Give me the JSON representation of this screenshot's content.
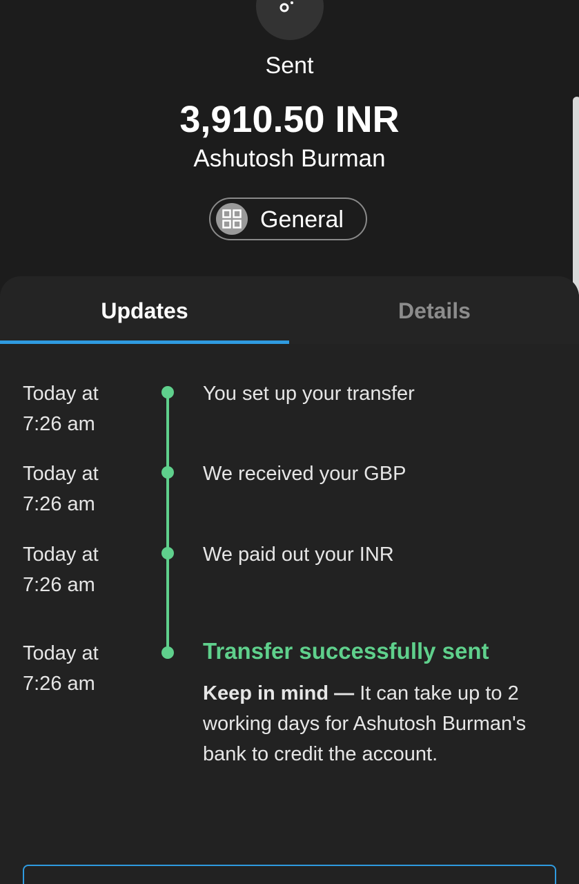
{
  "header": {
    "status_icon": "send-arrow-icon",
    "status_label": "Sent",
    "amount": "3,910.50 INR",
    "recipient": "Ashutosh Burman",
    "category": {
      "icon": "grid-icon",
      "label": "General"
    }
  },
  "tabs": [
    {
      "label": "Updates",
      "active": true
    },
    {
      "label": "Details",
      "active": false
    }
  ],
  "timeline": [
    {
      "time_line1": "Today at",
      "time_line2": "7:26 am",
      "text": "You set up your transfer"
    },
    {
      "time_line1": "Today at",
      "time_line2": "7:26 am",
      "text": "We received your GBP"
    },
    {
      "time_line1": "Today at",
      "time_line2": "7:26 am",
      "text": "We paid out your INR"
    },
    {
      "time_line1": "Today at",
      "time_line2": "7:26 am",
      "text": "Transfer successfully sent",
      "note_bold": "Keep in mind —",
      "note_rest": " It can take up to 2 working days for Ashutosh Burman's bank to credit the account."
    }
  ],
  "colors": {
    "accent_blue": "#2f9be0",
    "success_green": "#5fd08c",
    "background": "#1c1c1c"
  }
}
